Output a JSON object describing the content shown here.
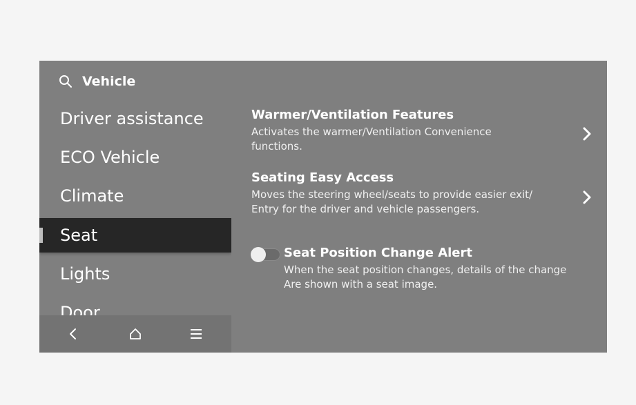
{
  "header": {
    "title": "Vehicle",
    "icon": "search-icon"
  },
  "sidebar": {
    "items": [
      {
        "label": "Driver assistance"
      },
      {
        "label": "ECO Vehicle"
      },
      {
        "label": "Climate"
      },
      {
        "label": "Seat",
        "active": true
      },
      {
        "label": "Lights"
      },
      {
        "label": "Door"
      }
    ]
  },
  "bottom_bar": {
    "icons": [
      "back-icon",
      "home-icon",
      "menu-icon"
    ]
  },
  "content": {
    "items": [
      {
        "title": "Warmer/Ventilation Features",
        "desc_line1": "Activates the warmer/Ventilation Convenience",
        "desc_line2": "functions."
      },
      {
        "title": "Seating Easy Access",
        "desc_line1": "Moves the steering wheel/seats to provide easier exit/",
        "desc_line2": "Entry for the driver and vehicle passengers."
      },
      {
        "title": "Seat Position Change Alert",
        "desc_line1": "When the seat position changes, details of the change",
        "desc_line2": "Are shown with a seat image.",
        "toggle_on": false
      }
    ]
  },
  "colors": {
    "screen_bg": "#7f7f7f",
    "active_item_bg": "#262626",
    "text": "#ffffff"
  }
}
